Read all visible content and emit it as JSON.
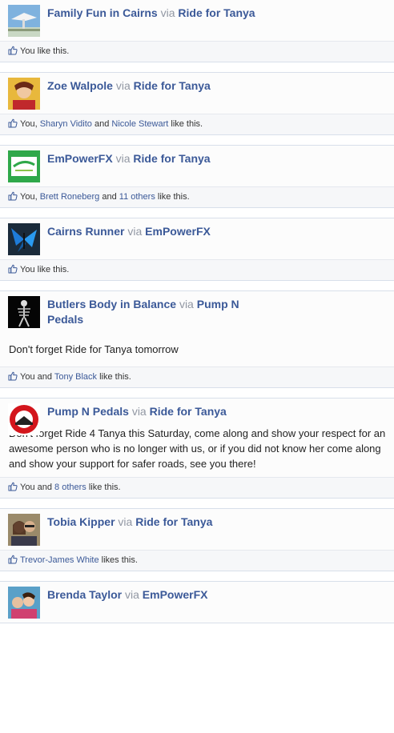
{
  "stories": [
    {
      "author": "Family Fun in Cairns",
      "via": "via",
      "app": "Ride for Tanya",
      "avatar_icon": "sculpture-photo",
      "text": "",
      "likes": [
        {
          "t": "You like this.",
          "link": false
        }
      ]
    },
    {
      "author": "Zoe Walpole",
      "via": "via",
      "app": "Ride for Tanya",
      "avatar_icon": "person-photo",
      "text": "",
      "likes": [
        {
          "t": "You, ",
          "link": false
        },
        {
          "t": "Sharyn Vidito",
          "link": true
        },
        {
          "t": " and ",
          "link": false
        },
        {
          "t": "Nicole Stewart",
          "link": true
        },
        {
          "t": " like this.",
          "link": false
        }
      ]
    },
    {
      "author": "EmPowerFX",
      "via": "via",
      "app": "Ride for Tanya",
      "avatar_icon": "empowerfx-logo",
      "text": "",
      "likes": [
        {
          "t": "You, ",
          "link": false
        },
        {
          "t": "Brett Roneberg",
          "link": true
        },
        {
          "t": " and ",
          "link": false
        },
        {
          "t": "11 others",
          "link": true
        },
        {
          "t": " like this.",
          "link": false
        }
      ]
    },
    {
      "author": "Cairns Runner",
      "via": "via",
      "app": "EmPowerFX",
      "avatar_icon": "butterfly-photo",
      "text": "",
      "likes": [
        {
          "t": "You like this.",
          "link": false
        }
      ]
    },
    {
      "author": "Butlers Body in Balance",
      "via": "via",
      "app": "Pump N Pedals",
      "avatar_icon": "skeleton-photo",
      "text": "Don't forget Ride for Tanya tomorrow",
      "likes": [
        {
          "t": "You and ",
          "link": false
        },
        {
          "t": "Tony Black",
          "link": true
        },
        {
          "t": " like this.",
          "link": false
        }
      ]
    },
    {
      "author": "Pump N Pedals",
      "via": "via",
      "app": "Ride for Tanya",
      "avatar_icon": "pumpnpedals-logo",
      "text": "Don't forget Ride 4 Tanya this Saturday, come along and show your respect for an awesome person who is no longer with us, or if you did not know her come along and show your support for safer roads, see you there!",
      "likes": [
        {
          "t": "You and ",
          "link": false
        },
        {
          "t": "8 others",
          "link": true
        },
        {
          "t": " like this.",
          "link": false
        }
      ]
    },
    {
      "author": "Tobia Kipper",
      "via": "via",
      "app": "Ride for Tanya",
      "avatar_icon": "couple-photo",
      "text": "",
      "likes": [
        {
          "t": "Trevor-James White",
          "link": true
        },
        {
          "t": " likes this.",
          "link": false
        }
      ]
    },
    {
      "author": "Brenda Taylor",
      "via": "via",
      "app": "EmPowerFX",
      "avatar_icon": "group-photo",
      "text": "",
      "likes": []
    }
  ]
}
